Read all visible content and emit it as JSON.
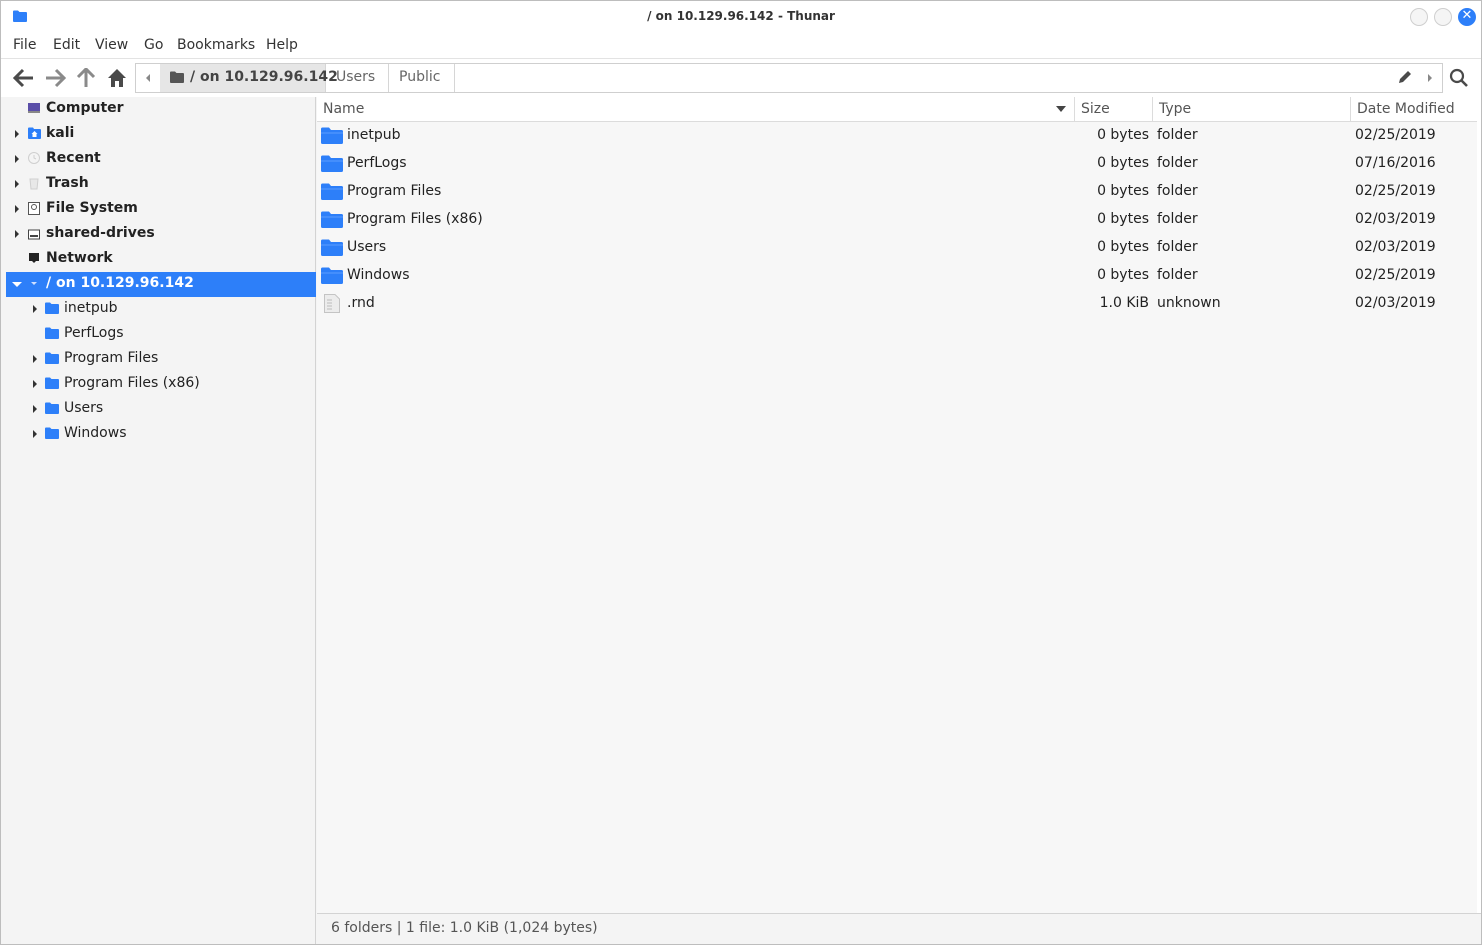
{
  "window": {
    "title": "/ on 10.129.96.142 - Thunar",
    "accent_color": "#2d7ff9",
    "folder_color": "#2d7ff9"
  },
  "menubar": {
    "items": [
      "File",
      "Edit",
      "View",
      "Go",
      "Bookmarks",
      "Help"
    ]
  },
  "toolbar": {
    "back_icon": "arrow-left-icon",
    "forward_icon": "arrow-right-icon",
    "up_icon": "arrow-up-icon",
    "home_icon": "home-icon",
    "edit_icon": "pencil-icon",
    "search_icon": "search-icon"
  },
  "pathbar": {
    "crumbs": [
      "/ on 10.129.96.142",
      "Users",
      "Public"
    ],
    "active_index": 0
  },
  "sidebar": {
    "items": [
      {
        "label": "Computer",
        "icon": "computer-icon",
        "bold": true,
        "expander": false
      },
      {
        "label": "kali",
        "icon": "home-folder-icon",
        "bold": true,
        "expander": true
      },
      {
        "label": "Recent",
        "icon": "clock-icon",
        "bold": true,
        "expander": true
      },
      {
        "label": "Trash",
        "icon": "trash-icon",
        "bold": true,
        "expander": true
      },
      {
        "label": "File System",
        "icon": "drive-icon",
        "bold": true,
        "expander": true
      },
      {
        "label": "shared-drives",
        "icon": "drive-icon",
        "bold": true,
        "expander": true
      },
      {
        "label": "Network",
        "icon": "network-icon",
        "bold": true,
        "expander": false
      },
      {
        "label": "/ on 10.129.96.142",
        "icon": "remote-share-icon",
        "bold": true,
        "expander": true,
        "expanded": true,
        "selected": true
      },
      {
        "label": "inetpub",
        "icon": "folder-icon",
        "bold": false,
        "expander": true,
        "child": true
      },
      {
        "label": "PerfLogs",
        "icon": "folder-icon",
        "bold": false,
        "expander": false,
        "child": true
      },
      {
        "label": "Program Files",
        "icon": "folder-icon",
        "bold": false,
        "expander": true,
        "child": true
      },
      {
        "label": "Program Files (x86)",
        "icon": "folder-icon",
        "bold": false,
        "expander": true,
        "child": true
      },
      {
        "label": "Users",
        "icon": "folder-icon",
        "bold": false,
        "expander": true,
        "child": true
      },
      {
        "label": "Windows",
        "icon": "folder-icon",
        "bold": false,
        "expander": true,
        "child": true
      }
    ]
  },
  "filelist": {
    "columns": {
      "name": "Name",
      "size": "Size",
      "type": "Type",
      "date": "Date Modified"
    },
    "rows": [
      {
        "name": "inetpub",
        "size": "0 bytes",
        "type": "folder",
        "date": "02/25/2019",
        "icon": "folder-icon"
      },
      {
        "name": "PerfLogs",
        "size": "0 bytes",
        "type": "folder",
        "date": "07/16/2016",
        "icon": "folder-icon"
      },
      {
        "name": "Program Files",
        "size": "0 bytes",
        "type": "folder",
        "date": "02/25/2019",
        "icon": "folder-icon"
      },
      {
        "name": "Program Files (x86)",
        "size": "0 bytes",
        "type": "folder",
        "date": "02/03/2019",
        "icon": "folder-icon"
      },
      {
        "name": "Users",
        "size": "0 bytes",
        "type": "folder",
        "date": "02/03/2019",
        "icon": "folder-icon"
      },
      {
        "name": "Windows",
        "size": "0 bytes",
        "type": "folder",
        "date": "02/25/2019",
        "icon": "folder-icon"
      },
      {
        "name": ".rnd",
        "size": "1.0 KiB",
        "type": "unknown",
        "date": "02/03/2019",
        "icon": "file-icon"
      }
    ]
  },
  "statusbar": {
    "text": "6 folders  |  1 file: 1.0 KiB (1,024 bytes)"
  }
}
